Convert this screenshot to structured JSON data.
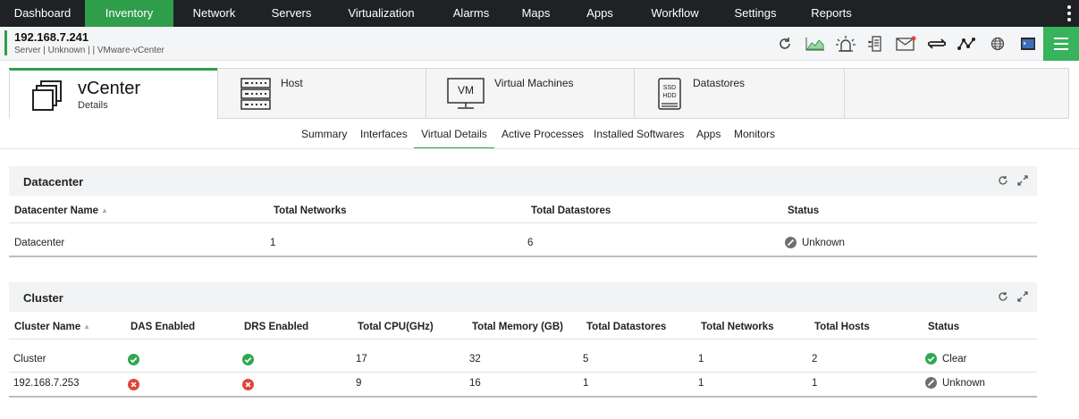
{
  "nav": {
    "tabs": [
      {
        "label": "Dashboard",
        "active": false
      },
      {
        "label": "Inventory",
        "active": true
      },
      {
        "label": "Network",
        "active": false
      },
      {
        "label": "Servers",
        "active": false
      },
      {
        "label": "Virtualization",
        "active": false
      },
      {
        "label": "Alarms",
        "active": false
      },
      {
        "label": "Maps",
        "active": false
      },
      {
        "label": "Apps",
        "active": false
      },
      {
        "label": "Workflow",
        "active": false
      },
      {
        "label": "Settings",
        "active": false
      },
      {
        "label": "Reports",
        "active": false
      }
    ]
  },
  "device": {
    "ip": "192.168.7.241",
    "subtitle": "Server | Unknown |  | VMware-vCenter",
    "tool_icons": [
      "refresh-icon",
      "graph-icon",
      "alarm-icon",
      "network-icon",
      "mail-icon",
      "sync-icon",
      "topology-icon",
      "globe-icon",
      "terminal-icon"
    ]
  },
  "entity_tabs": {
    "vcenter": {
      "title": "vCenter",
      "subtitle": "Details"
    },
    "host": {
      "title": "Host"
    },
    "vms": {
      "title": "Virtual Machines",
      "icon_text": "VM"
    },
    "datastores": {
      "title": "Datastores",
      "icon_text1": "SSD",
      "icon_text2": "HDD"
    }
  },
  "subtabs": [
    {
      "label": "Summary",
      "active": false
    },
    {
      "label": "Interfaces",
      "active": false
    },
    {
      "label": "Virtual Details",
      "active": true
    },
    {
      "label": "Active Processes",
      "active": false
    },
    {
      "label": "Installed Softwares",
      "active": false
    },
    {
      "label": "Apps",
      "active": false
    },
    {
      "label": "Monitors",
      "active": false
    }
  ],
  "datacenter": {
    "title": "Datacenter",
    "headers": [
      "Datacenter Name",
      "Total Networks",
      "Total Datastores",
      "Status"
    ],
    "rows": [
      {
        "name": "Datacenter",
        "networks": "1",
        "datastores": "6",
        "status": "Unknown"
      }
    ]
  },
  "cluster": {
    "title": "Cluster",
    "headers": [
      "Cluster Name",
      "DAS Enabled",
      "DRS Enabled",
      "Total CPU(GHz)",
      "Total Memory (GB)",
      "Total Datastores",
      "Total Networks",
      "Total Hosts",
      "Status"
    ],
    "rows": [
      {
        "name": "Cluster",
        "das": "enabled",
        "drs": "enabled",
        "cpu": "17",
        "memory": "32",
        "datastores": "5",
        "networks": "1",
        "hosts": "2",
        "status": "Clear"
      },
      {
        "name": "192.168.7.253",
        "das": "disabled",
        "drs": "disabled",
        "cpu": "9",
        "memory": "16",
        "datastores": "1",
        "networks": "1",
        "hosts": "1",
        "status": "Unknown"
      }
    ]
  },
  "colors": {
    "accent": "#2f9e4a",
    "ok": "#2fa84f",
    "error": "#e0453a",
    "unknown": "#6f6f6f",
    "nav_bg": "#1f2124"
  }
}
